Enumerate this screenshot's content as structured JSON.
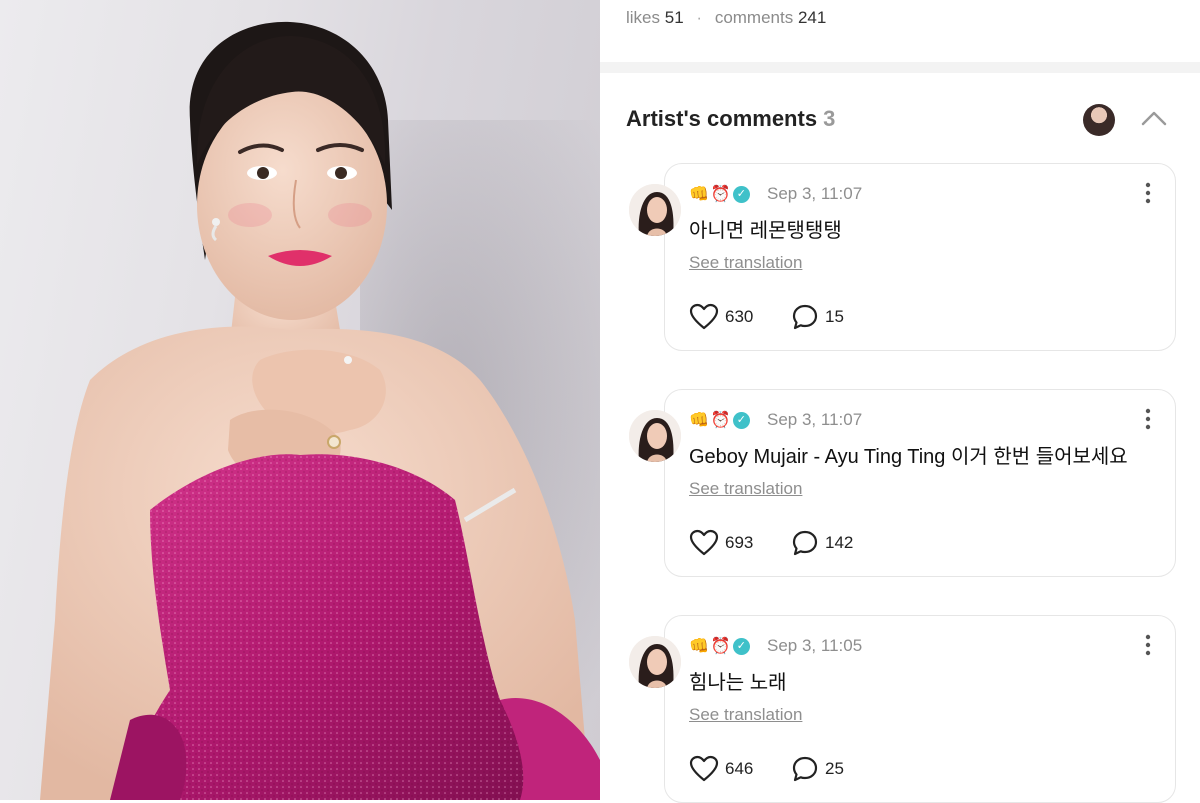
{
  "stats": {
    "likes_label": "likes",
    "likes_count": "51",
    "separator": "·",
    "comments_label": "comments",
    "comments_count": "241"
  },
  "section": {
    "title": "Artist's comments",
    "count": "3"
  },
  "comments": [
    {
      "time": "Sep 3, 11:07",
      "text": "아니면 레몬탱탱탱",
      "translation_link": "See translation",
      "likes": "630",
      "replies": "15"
    },
    {
      "time": "Sep 3, 11:07",
      "text": "Geboy Mujair - Ayu Ting Ting 이거 한번 들어보세요",
      "translation_link": "See translation",
      "likes": "693",
      "replies": "142"
    },
    {
      "time": "Sep 3, 11:05",
      "text": "힘나는 노래",
      "translation_link": "See translation",
      "likes": "646",
      "replies": "25"
    }
  ],
  "icons": {
    "badge_1": "fist-emoji-icon",
    "badge_2": "alarm-clock-emoji-icon",
    "badge_3": "verified-check-icon",
    "like": "heart-icon",
    "reply": "speech-bubble-icon",
    "more": "vertical-dots-icon",
    "collapse": "chevron-up-icon"
  },
  "colors": {
    "verified": "#3fc1c9",
    "muted_text": "#8e8e8e",
    "dress_magenta": "#b0186e"
  }
}
